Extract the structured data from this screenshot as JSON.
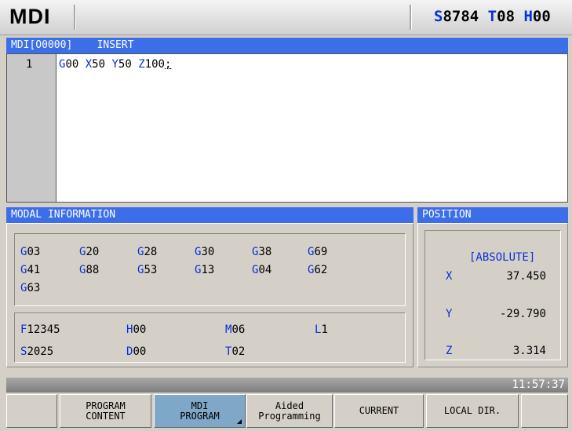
{
  "header": {
    "mode": "MDI",
    "spindle": "S8784",
    "tool": "T08",
    "h_offset": "H00"
  },
  "editor": {
    "title": "MDI[O0000]    INSERT",
    "line_number": "1",
    "code": [
      {
        "addr": "G",
        "num": "00 "
      },
      {
        "addr": "X",
        "num": "50 "
      },
      {
        "addr": "Y",
        "num": "50 "
      },
      {
        "addr": "Z",
        "num": "100"
      },
      {
        "addr": "",
        "num": ";"
      }
    ]
  },
  "modal": {
    "title": "MODAL INFORMATION",
    "row1": [
      "G03",
      "G20",
      "G28",
      "G30",
      "G38",
      "G69"
    ],
    "row2": [
      "G41",
      "G88",
      "G53",
      "G13",
      "G04",
      "G62"
    ],
    "row3": [
      "G63"
    ],
    "f": "F12345",
    "h": "H00",
    "m": "M06",
    "l": "L1",
    "s": "S2025",
    "d": "D00",
    "t": "T02"
  },
  "position": {
    "title": "POSITION",
    "mode": "[ABSOLUTE]",
    "x_label": "X",
    "x_value": "37.450",
    "y_label": "Y",
    "y_value": "-29.790",
    "z_label": "Z",
    "z_value": "3.314"
  },
  "status": {
    "clock": "11:57:37"
  },
  "softkeys": {
    "program_content": "PROGRAM\nCONTENT",
    "mdi_program": "MDI\nPROGRAM",
    "aided_programming": "Aided\nProgramming",
    "current": "CURRENT",
    "local_dir": "LOCAL DIR."
  },
  "colors": {
    "accent_blue": "#3d6ee9",
    "address_blue": "#0a2fd6",
    "active_key": "#7ea7c8"
  }
}
